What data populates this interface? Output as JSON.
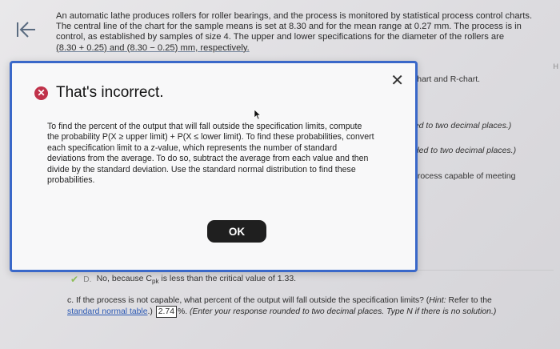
{
  "problem": {
    "line1": "An automatic lathe produces rollers for roller bearings, and the process is monitored by statistical process control charts.",
    "line2": "The central line of the chart for the sample means is set at 8.30 and for the mean range at 0.27 mm. The process is in",
    "line3": "control, as established by samples of size 4. The upper and lower specifications for the diameter of the rollers are",
    "line4": "(8.30 + 0.25) and (8.30 − 0.25) mm, respectively."
  },
  "right_fragments": {
    "charts": "chart and R-chart.",
    "rounded1": "ded to two decimal places.)",
    "rounded2": "nded to two decimal places.)",
    "capable": "process capable of meeting",
    "edge": "H"
  },
  "modal": {
    "title": "That's incorrect.",
    "close_symbol": "✕",
    "body": "To find the percent of the output that will fall outside the specification limits, compute the probability P(X ≥ upper limit) + P(X ≤ lower limit). To find these probabilities, convert each specification limit to a z-value, which represents the number of standard deviations from the average. To do so, subtract the average from each value and then divide by the standard deviation. Use the standard normal distribution to find these probabilities.",
    "ok_label": "OK"
  },
  "option_d": {
    "letter": "D.",
    "text_pre": "No, because C",
    "subscript": "pk",
    "text_post": " is less than the critical value of 1.33."
  },
  "question_c": {
    "prefix": "c. If the process is not capable, what percent of the output will fall outside the specification limits? (",
    "hint_label": "Hint:",
    "hint_text": " Refer to the",
    "link_text": "standard normal table",
    "after_link": ".)",
    "answer_value": "2.74",
    "after_answer": "%. ",
    "instruction": "(Enter your response rounded to two decimal places. Type N if there is no solution.)"
  },
  "colors": {
    "modal_border": "#3a68c9",
    "error_icon": "#c0324a",
    "ok_button": "#1f1f1f",
    "link": "#2a58b3",
    "check": "#8fbf5a"
  }
}
